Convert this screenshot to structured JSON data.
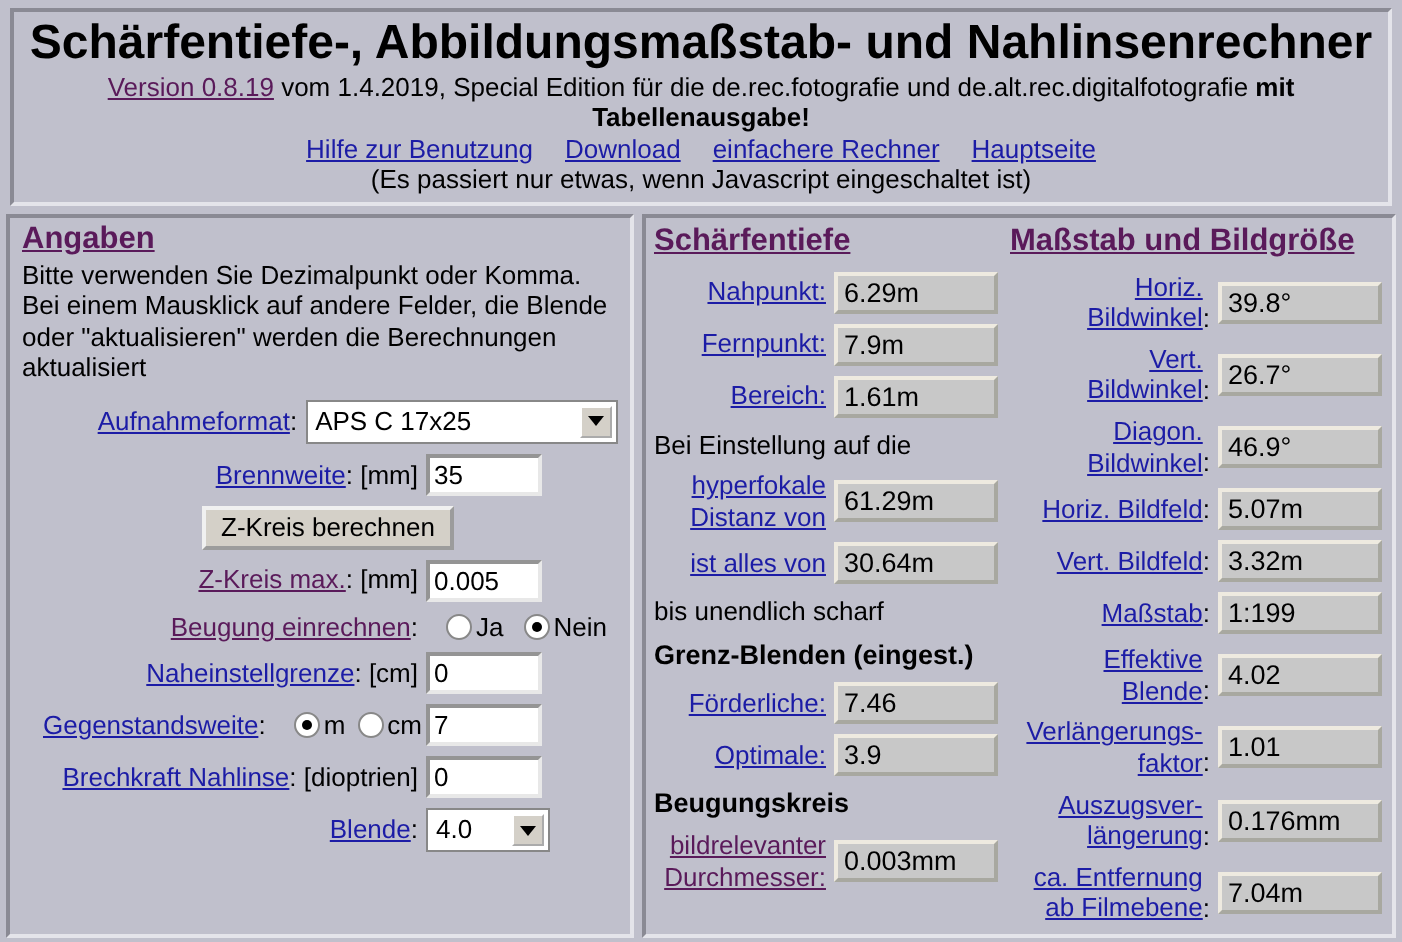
{
  "header": {
    "title": "Schärfentiefe-, Abbildungsmaßstab- und Nahlinsenrechner",
    "version_link": {
      "text": "Version 0.8.19",
      "visited": true
    },
    "intro": "vom 1.4.2019, Special Edition für die de.rec.fotografie und de.alt.rec.digitalfotografie **mit Tabellenausgabe!**",
    "nav_links": [
      {
        "text": "Hilfe zur Benutzung",
        "visited": false
      },
      {
        "text": "Download",
        "visited": false
      },
      {
        "text": "einfachere Rechner",
        "visited": false
      },
      {
        "text": "Hauptseite",
        "visited": false
      }
    ],
    "note": "(Es passiert nur etwas, wenn Javascript eingeschaltet ist)"
  },
  "inputs": {
    "heading": {
      "text": "Angaben",
      "visited": true
    },
    "instructions": "Bitte verwenden Sie Dezimalpunkt oder Komma. Bei einem Mausklick auf andere Felder, die Blende oder \"aktualisieren\" werden die Berechnungen aktualisiert",
    "rows": [
      {
        "kind": "wide-select",
        "label": "Aufnahmeformat",
        "visited": false,
        "unit": ":",
        "value": "APS C 17x25"
      },
      {
        "kind": "input",
        "label": "Brennweite",
        "visited": false,
        "unit": ":  [mm]",
        "value": "35"
      },
      {
        "kind": "button",
        "text": "Z-Kreis berechnen"
      },
      {
        "kind": "input",
        "label": "Z-Kreis max.",
        "visited": true,
        "unit": ": [mm]",
        "value": "0.005"
      },
      {
        "kind": "radios",
        "label": "Beugung einrechnen",
        "visited": true,
        "unit": ":",
        "options": [
          {
            "text": "Ja",
            "selected": false
          },
          {
            "text": "Nein",
            "selected": true
          }
        ]
      },
      {
        "kind": "input",
        "label": "Naheinstellgrenze",
        "visited": false,
        "unit": ": [cm]",
        "value": "0"
      },
      {
        "kind": "radio-input",
        "label": "Gegenstandsweite",
        "visited": false,
        "unit": ":",
        "options": [
          {
            "text": "m",
            "selected": true
          },
          {
            "text": "cm",
            "selected": false
          }
        ],
        "value": "7"
      },
      {
        "kind": "input",
        "label": "Brechkraft Nahlinse",
        "visited": false,
        "unit": ": [dioptrien]",
        "value": "0"
      },
      {
        "kind": "select",
        "label": "Blende",
        "visited": false,
        "unit": ":",
        "value": "4.0"
      }
    ]
  },
  "depth_of_field": {
    "heading": {
      "text": "Schärfentiefe",
      "visited": true
    },
    "rows": [
      {
        "kind": "output",
        "label": "Nahpunkt:",
        "visited": false,
        "value": "6.29m"
      },
      {
        "kind": "output",
        "label": "Fernpunkt:",
        "visited": false,
        "value": "7.9m"
      },
      {
        "kind": "output",
        "label": "Bereich:",
        "visited": false,
        "value": "1.61m"
      },
      {
        "kind": "text",
        "text": "Bei Einstellung auf die"
      },
      {
        "kind": "output",
        "label": "hyperfokale\nDistanz von",
        "visited": false,
        "value": "61.29m"
      },
      {
        "kind": "output",
        "label": "ist alles von",
        "visited": false,
        "value": "30.64m"
      },
      {
        "kind": "text",
        "text": "bis unendlich scharf"
      },
      {
        "kind": "subheading",
        "text": "Grenz-Blenden (eingest.)"
      },
      {
        "kind": "output",
        "label": "Förderliche:",
        "visited": false,
        "value": "7.46"
      },
      {
        "kind": "output",
        "label": "Optimale:",
        "visited": false,
        "value": "3.9"
      },
      {
        "kind": "subheading",
        "text": "Beugungskreis"
      },
      {
        "kind": "output",
        "label": "bildrelevanter\nDurchmesser:",
        "visited": true,
        "value": "0.003mm"
      }
    ]
  },
  "scale": {
    "heading": {
      "text": "Maßstab und Bildgröße",
      "visited": true
    },
    "rows": [
      {
        "label": "Horiz.\nBildwinkel",
        "visited": false,
        "value": "39.8°"
      },
      {
        "label": "Vert.\nBildwinkel",
        "visited": false,
        "value": "26.7°"
      },
      {
        "label": "Diagon.\nBildwinkel",
        "visited": false,
        "value": "46.9°"
      },
      {
        "label": "Horiz. Bildfeld",
        "visited": false,
        "value": "5.07m"
      },
      {
        "label": "Vert. Bildfeld",
        "visited": false,
        "value": "3.32m"
      },
      {
        "label": "Maßstab",
        "visited": false,
        "value": "1:199"
      },
      {
        "label": "Effektive\nBlende",
        "visited": false,
        "value": "4.02"
      },
      {
        "label": "Verlängerungs-\nfaktor",
        "visited": false,
        "value": "1.01"
      },
      {
        "label": "Auszugsver-\nlängerung",
        "visited": false,
        "value": "0.176mm"
      },
      {
        "label": "ca. Entfernung\nab Filmebene",
        "visited": false,
        "value": "7.04m"
      }
    ],
    "suffix": ":"
  }
}
